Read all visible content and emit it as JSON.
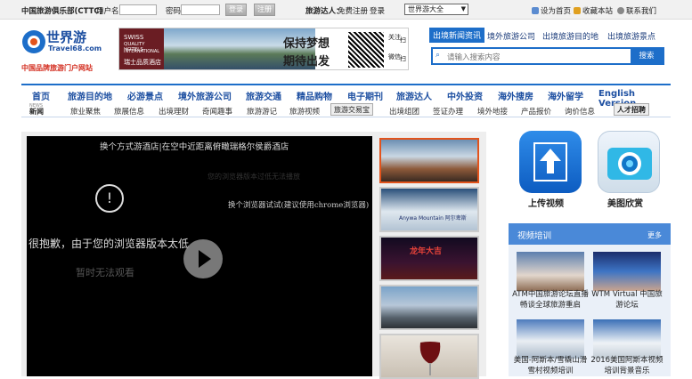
{
  "topbar": {
    "club": "中国旅游俱乐部(CTTC)",
    "username_label": "用户名",
    "password_label": "密码",
    "login_btn": "登录",
    "register_btn": "注册",
    "talent_label": "旅游达人：",
    "free_register": "免费注册",
    "talent_login": "登录",
    "site_select": "世界游大全",
    "set_home": "设为首页",
    "bookmark": "收藏本站",
    "contact": "联系我们"
  },
  "logo": {
    "text": "世界游",
    "domain": "Travel68.com",
    "slogan": "中国品牌旅游门户网站"
  },
  "banner": {
    "brand1": "SWISS",
    "brand2": "QUALITY HOTELS",
    "brand3": "INTERNATIONAL",
    "cn": "瑞士品质酒店",
    "line1": "保持梦想",
    "line2": "期待出发",
    "follow1": "关注",
    "follow2": "微信",
    "scan1": "扫",
    "scan2": "扫"
  },
  "right_tabs": [
    "出境新闻资讯",
    "境外旅游公司",
    "出境旅游目的地",
    "出境旅游景点"
  ],
  "search": {
    "placeholder": "请输入搜索内容",
    "button": "搜索"
  },
  "nav_main": [
    "首页",
    "旅游目的地",
    "必游景点",
    "境外旅游公司",
    "旅游交通",
    "精品购物",
    "电子期刊",
    "旅游达人",
    "中外投资",
    "海外搜房",
    "海外留学",
    "English Version"
  ],
  "nav_news_badge": "新闻",
  "nav_news_small": "NEWS",
  "nav_sub_left": [
    "旅业聚焦",
    "旅展信息",
    "出境理财",
    "奇闻趣事",
    "旅游游记",
    "旅游视频"
  ],
  "nav_trade_badge": "旅游交易宝",
  "nav_sub_right": [
    "出境组团",
    "签证办理",
    "境外地接",
    "产品报价",
    "询价信息"
  ],
  "nav_talent_badge": "人才招聘",
  "player": {
    "title": "换个方式游酒店|在空中近距离俯瞰瑞格尔侯爵酒店",
    "err1": "很抱歉，由于您的浏览器版本太低",
    "err2": "暂时无法观看",
    "hint": "换个浏览器试试(建议使用chrome浏览器)",
    "faint": "您的浏览器版本过低无法播放",
    "warn_symbol": "!"
  },
  "thumbs": [
    {
      "name": "thumb-hotel"
    },
    {
      "name": "thumb-ski",
      "caption": "Anywa Mountain 阿尔卑斯"
    },
    {
      "name": "thumb-night",
      "caption": "龙年大吉"
    },
    {
      "name": "thumb-city"
    },
    {
      "name": "thumb-wine"
    }
  ],
  "apps": [
    {
      "label": "上传视频"
    },
    {
      "label": "美图欣赏"
    }
  ],
  "video_training": {
    "title": "视频培训",
    "more": "更多",
    "items": [
      {
        "caption": "ATM中国旅游论坛直播畅谈全球旅游重启"
      },
      {
        "caption": "WTM Virtual 中国旅游论坛"
      },
      {
        "caption": "美国-阿斯本/雪橇山滑雪村视频培训"
      },
      {
        "caption": "2016美国阿斯本视频培训背景音乐"
      }
    ]
  },
  "colors": {
    "accent": "#1d6ec9",
    "nav_text": "#1d4fa1",
    "highlight": "#e2531c"
  }
}
